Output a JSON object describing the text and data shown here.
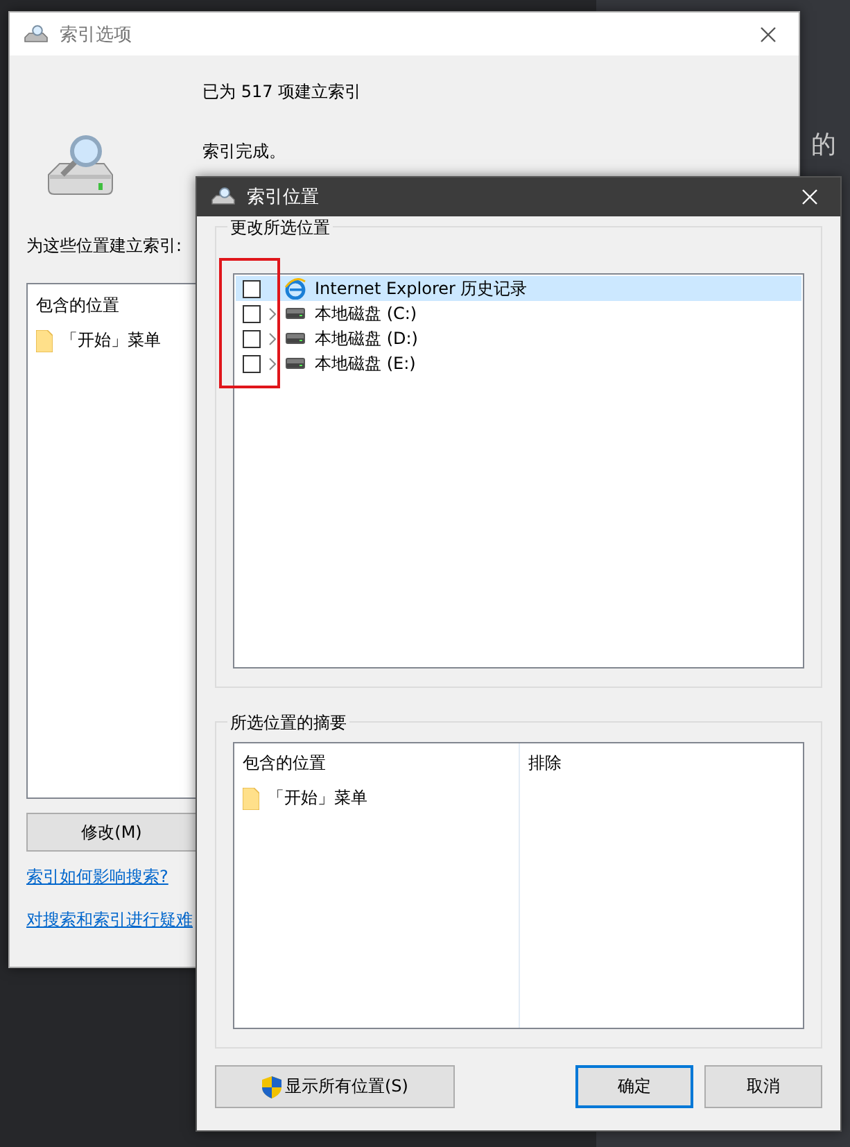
{
  "background_text": "的",
  "main_window": {
    "title": "索引选项",
    "count_text": "已为 517 项建立索引",
    "status": "索引完成。",
    "locations_label": "为这些位置建立索引:",
    "list": {
      "header": "包含的位置",
      "items": [
        "「开始」菜单"
      ]
    },
    "modify_button": "修改(M)",
    "links": [
      "索引如何影响搜索?",
      "对搜索和索引进行疑难"
    ]
  },
  "dialog": {
    "title": "索引位置",
    "change_group": {
      "label": "更改所选位置",
      "tree": [
        {
          "label": "Internet Explorer 历史记录",
          "kind": "history",
          "checked": false,
          "expandable": false,
          "selected": true
        },
        {
          "label": "本地磁盘 (C:)",
          "kind": "drive",
          "checked": false,
          "expandable": true,
          "selected": false
        },
        {
          "label": "本地磁盘 (D:)",
          "kind": "drive",
          "checked": false,
          "expandable": true,
          "selected": false
        },
        {
          "label": "本地磁盘 (E:)",
          "kind": "drive",
          "checked": false,
          "expandable": true,
          "selected": false
        }
      ]
    },
    "summary_group": {
      "label": "所选位置的摘要",
      "columns": [
        "包含的位置",
        "排除"
      ],
      "included": [
        "「开始」菜单"
      ]
    },
    "buttons": [
      {
        "label": "显示所有位置(S)",
        "kind": "shield",
        "default": false
      },
      {
        "label": "确定",
        "kind": "plain",
        "default": true
      },
      {
        "label": "取消",
        "kind": "plain",
        "default": false
      }
    ]
  }
}
